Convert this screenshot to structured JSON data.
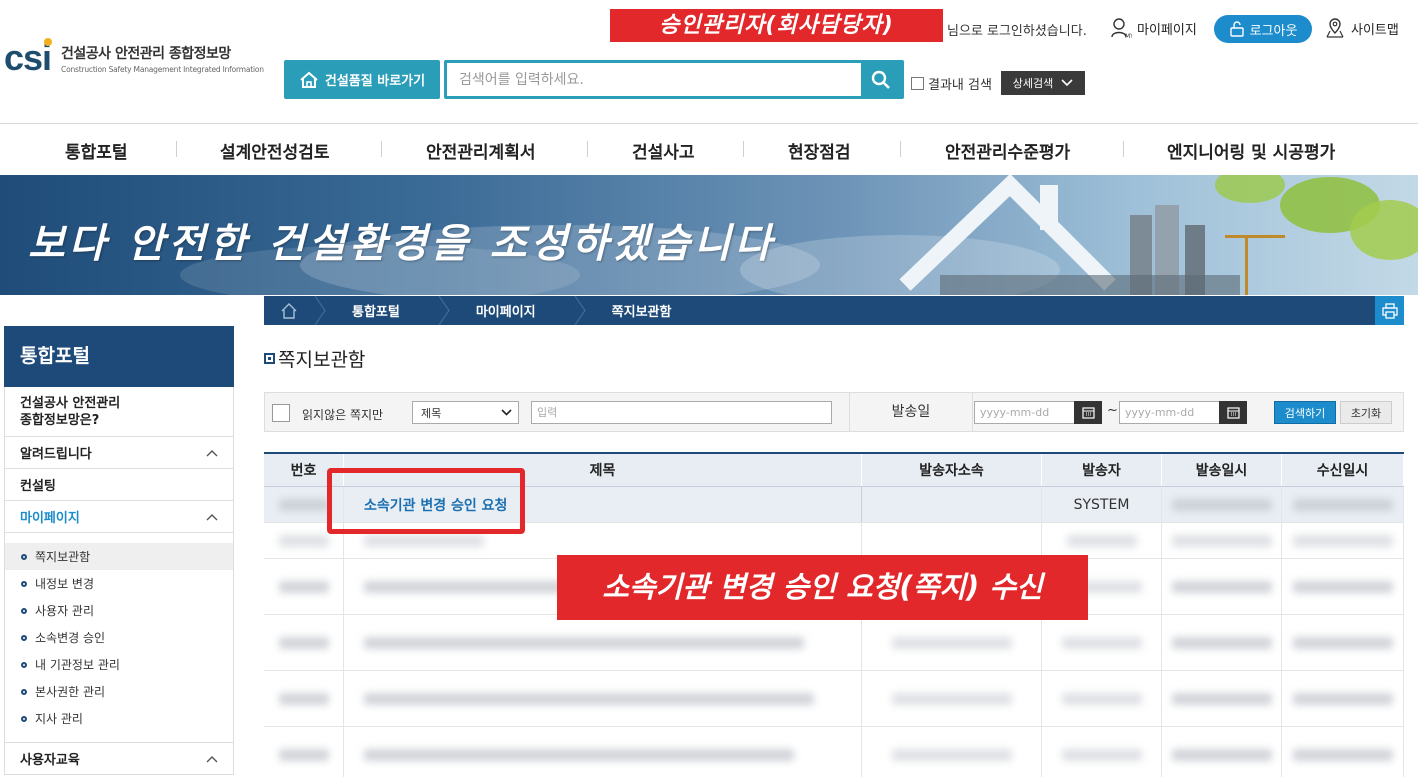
{
  "header": {
    "logo_mark": "csi",
    "logo_title": "건설공사 안전관리 종합정보망",
    "logo_subtitle": "Construction Safety Management Integrated Information",
    "admin_label": "승인관리자(회사담당자)",
    "login_message": "님으로 로그인하셨습니다.",
    "mypage": "마이페이지",
    "logout": "로그아웃",
    "sitemap": "사이트맵",
    "quality_shortcut": "건설품질 바로가기",
    "search_placeholder": "검색어를 입력하세요.",
    "in_result_label": "결과내 검색",
    "detail_search": "상세검색"
  },
  "gnb": [
    "통합포털",
    "설계안전성검토",
    "안전관리계획서",
    "건설사고",
    "현장점검",
    "안전관리수준평가",
    "엔지니어링 및 시공평가"
  ],
  "hero": {
    "slogan": "보다 안전한 건설환경을 조성하겠습니다"
  },
  "breadcrumb": [
    "통합포털",
    "마이페이지",
    "쪽지보관함"
  ],
  "sidebar": {
    "title": "통합포털",
    "intro": "건설공사 안전관리\n종합정보망은?",
    "items": [
      {
        "label": "알려드립니다"
      },
      {
        "label": "컨설팅"
      },
      {
        "label": "마이페이지"
      },
      {
        "label": "사용자교육"
      }
    ],
    "sub_items": [
      "쪽지보관함",
      "내정보 변경",
      "사용자 관리",
      "소속변경 승인",
      "내 기관정보 관리",
      "본사권한 관리",
      "지사 관리"
    ]
  },
  "main": {
    "page_title": "쪽지보관함",
    "filter": {
      "unread_only": "읽지않은 쪽지만",
      "field_select": "제목",
      "keyword_placeholder": "입력",
      "date_label": "발송일",
      "date_placeholder": "yyyy-mm-dd",
      "tilde": "~",
      "search": "검색하기",
      "reset": "초기화"
    },
    "columns": [
      "번호",
      "제목",
      "발송자소속",
      "발송자",
      "발송일시",
      "수신일시"
    ],
    "first_row": {
      "title": "소속기관 변경 승인 요청",
      "sender": "SYSTEM"
    }
  },
  "annotation": {
    "callout": "소속기관 변경 승인 요청(쪽지) 수신"
  },
  "colors": {
    "navy": "#1d4a78",
    "blue": "#1c8ccc",
    "teal": "#2a9db8",
    "red": "#e3282b"
  }
}
